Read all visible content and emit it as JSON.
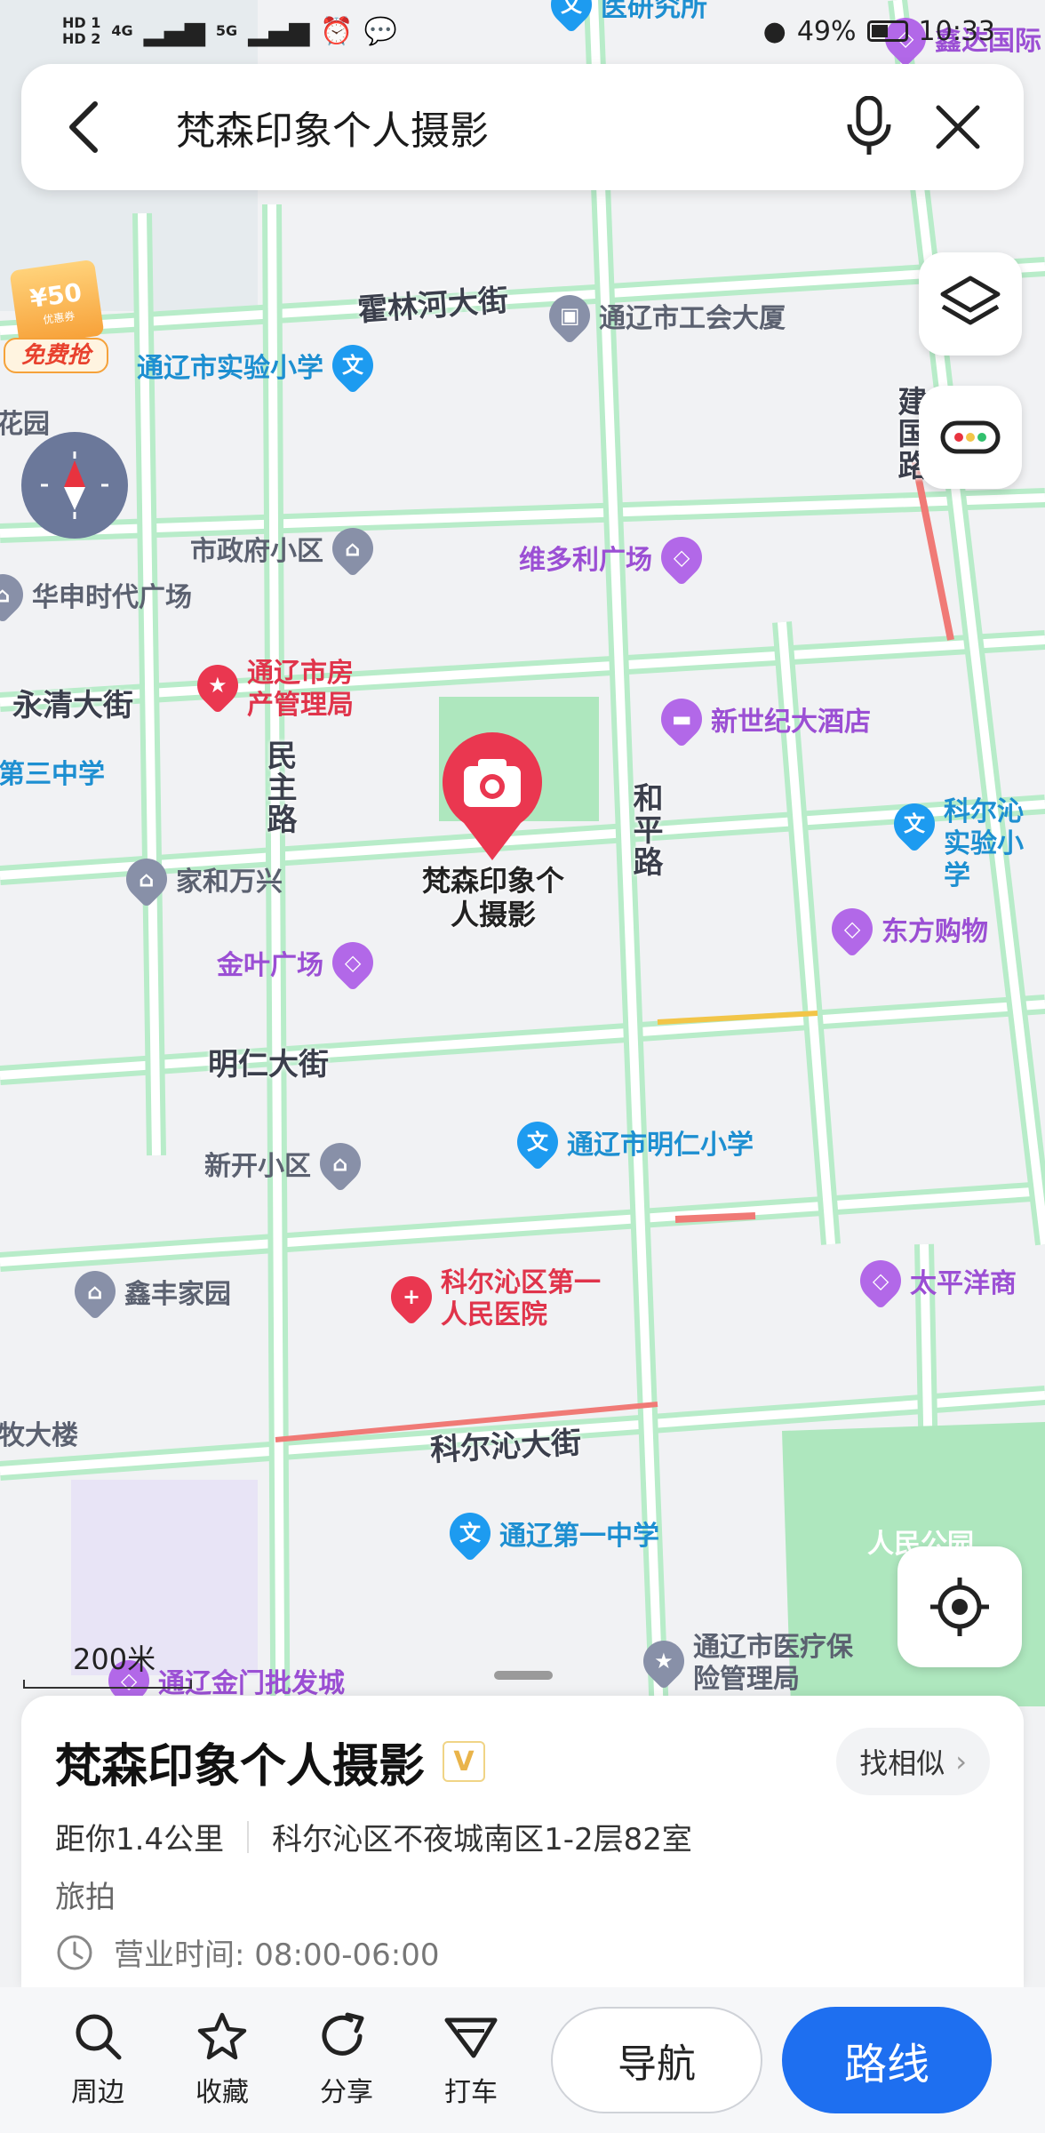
{
  "status_bar": {
    "hd1": "HD 1",
    "hd2": "HD 2",
    "net1": "4G",
    "net2": "5G",
    "battery": "49%",
    "time": "10:33"
  },
  "search": {
    "query": "梵森印象个人摄影"
  },
  "map": {
    "coupon": {
      "amount": "¥50",
      "tag": "优惠券",
      "label": "免费抢"
    },
    "roads": [
      {
        "name": "霍林河大街"
      },
      {
        "name": "永清大街"
      },
      {
        "name": "明仁大街"
      },
      {
        "name": "科尔沁大街"
      },
      {
        "name": "民主路"
      },
      {
        "name": "和平路"
      },
      {
        "name": "建国路"
      }
    ],
    "pois": [
      {
        "name": "医研究所",
        "kind": "blue"
      },
      {
        "name": "鑫达国际",
        "kind": "purple"
      },
      {
        "name": "通辽市工会大厦",
        "kind": "gray"
      },
      {
        "name": "通辽市实验小学",
        "kind": "blue"
      },
      {
        "name": "花园",
        "kind": "gray"
      },
      {
        "name": "市政府小区",
        "kind": "gray"
      },
      {
        "name": "维多利广场",
        "kind": "purple"
      },
      {
        "name": "华申时代广场",
        "kind": "gray"
      },
      {
        "name": "通辽市房产管理局",
        "kind": "red"
      },
      {
        "name": "新世纪大酒店",
        "kind": "purple"
      },
      {
        "name": "第三中学",
        "kind": "blue"
      },
      {
        "name": "科尔沁实验小学",
        "kind": "blue"
      },
      {
        "name": "家和万兴",
        "kind": "gray"
      },
      {
        "name": "东方购物",
        "kind": "purple"
      },
      {
        "name": "金叶广场",
        "kind": "purple"
      },
      {
        "name": "通辽市明仁小学",
        "kind": "blue"
      },
      {
        "name": "新开小区",
        "kind": "gray"
      },
      {
        "name": "鑫丰家园",
        "kind": "gray"
      },
      {
        "name": "科尔沁区第一人民医院",
        "kind": "red"
      },
      {
        "name": "太平洋商",
        "kind": "purple"
      },
      {
        "name": "牧大楼",
        "kind": "gray"
      },
      {
        "name": "通辽第一中学",
        "kind": "blue"
      },
      {
        "name": "人民公园",
        "kind": "gray"
      },
      {
        "name": "通辽市医疗保险管理局",
        "kind": "gray"
      },
      {
        "name": "通辽金门批发城",
        "kind": "purple"
      }
    ],
    "selected_label": "梵森印象个人摄影",
    "scale": "200米"
  },
  "place": {
    "name": "梵森印象个人摄影",
    "badge": "V",
    "similar_button": "找相似",
    "distance": "距你1.4公里",
    "address": "科尔沁区不夜城南区1-2层82室",
    "category": "旅拍",
    "hours": "营业时间: 08:00-06:00"
  },
  "actions": {
    "nearby": "周边",
    "favorite": "收藏",
    "share": "分享",
    "taxi": "打车",
    "navigate": "导航",
    "route": "路线"
  },
  "colors": {
    "road": "#b8ecc9",
    "primary": "#1e6ff0",
    "marker": "#ea3750"
  }
}
